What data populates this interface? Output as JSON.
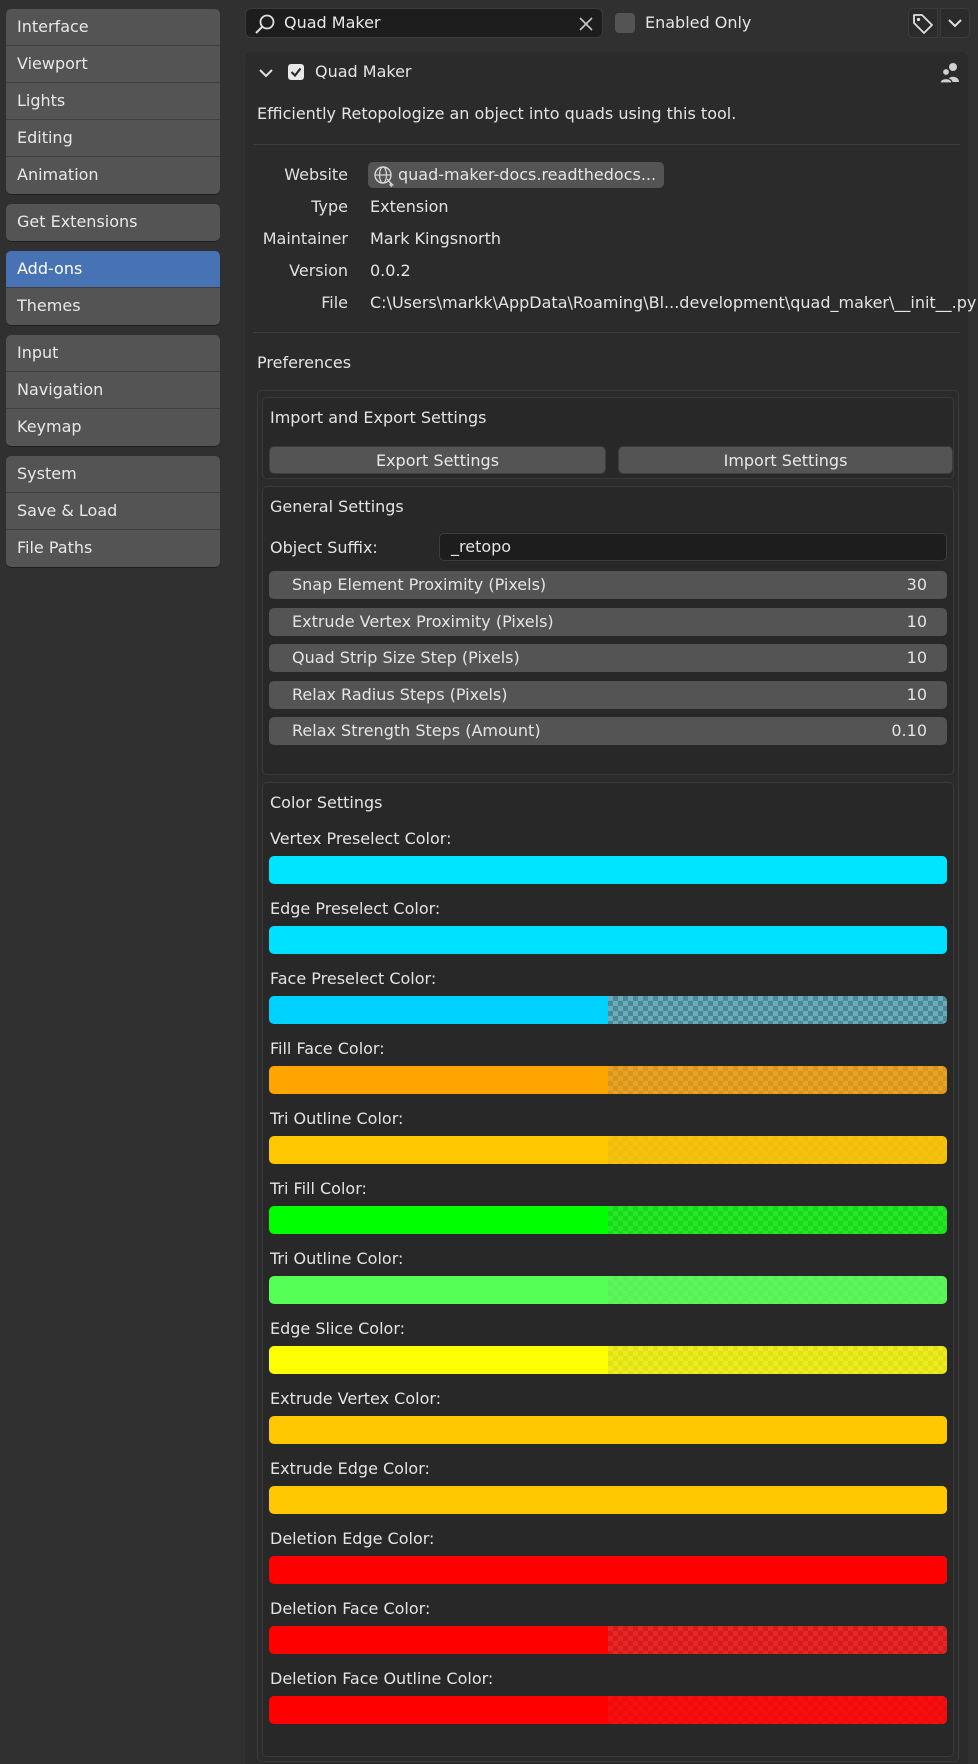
{
  "sidebar": {
    "groups": [
      [
        "Interface",
        "Viewport",
        "Lights",
        "Editing",
        "Animation"
      ],
      [
        "Get Extensions"
      ],
      [
        "Add-ons",
        "Themes"
      ],
      [
        "Input",
        "Navigation",
        "Keymap"
      ],
      [
        "System",
        "Save & Load",
        "File Paths"
      ]
    ],
    "active": "Add-ons"
  },
  "topbar": {
    "search_value": "Quad Maker",
    "enabled_only_label": "Enabled Only",
    "enabled_only_checked": false
  },
  "addon": {
    "name": "Quad Maker",
    "enabled": true,
    "description": "Efficiently Retopologize an object into quads using this tool.",
    "info": {
      "website_label": "Website",
      "website": "quad-maker-docs.readthedocs...",
      "type_label": "Type",
      "type": "Extension",
      "maintainer_label": "Maintainer",
      "maintainer": "Mark Kingsnorth",
      "version_label": "Version",
      "version": "0.0.2",
      "file_label": "File",
      "file": "C:\\Users\\markk\\AppData\\Roaming\\Bl...development\\quad_maker\\__init__.py"
    }
  },
  "preferences": {
    "label": "Preferences",
    "import_export": {
      "title": "Import and Export Settings",
      "export_label": "Export Settings",
      "import_label": "Import Settings"
    },
    "general": {
      "title": "General Settings",
      "object_suffix_label": "Object Suffix:",
      "object_suffix_value": "_retopo",
      "sliders": [
        {
          "label": "Snap Element Proximity (Pixels)",
          "value": "30"
        },
        {
          "label": "Extrude Vertex Proximity (Pixels)",
          "value": "10"
        },
        {
          "label": "Quad Strip Size Step (Pixels)",
          "value": "10"
        },
        {
          "label": "Relax Radius Steps (Pixels)",
          "value": "10"
        },
        {
          "label": "Relax Strength Steps (Amount)",
          "value": "0.10"
        }
      ]
    },
    "colors": {
      "title": "Color Settings",
      "items": [
        {
          "label": "Vertex Preselect Color:",
          "color": "#00e5ff",
          "alpha": 1.0
        },
        {
          "label": "Edge Preselect Color:",
          "color": "#00e1ff",
          "alpha": 1.0
        },
        {
          "label": "Face Preselect Color:",
          "color": "#00d2ff",
          "alpha": 0.3
        },
        {
          "label": "Fill Face Color:",
          "color": "#ffa500",
          "alpha": 0.75
        },
        {
          "label": "Tri Outline Color:",
          "color": "#ffc800",
          "alpha": 0.9
        },
        {
          "label": "Tri Fill Color:",
          "color": "#00ff00",
          "alpha": 0.75
        },
        {
          "label": "Tri Outline Color:",
          "color": "#55ff55",
          "alpha": 0.9
        },
        {
          "label": "Edge Slice Color:",
          "color": "#ffff00",
          "alpha": 0.8
        },
        {
          "label": "Extrude Vertex Color:",
          "color": "#ffc800",
          "alpha": 1.0
        },
        {
          "label": "Extrude Edge Color:",
          "color": "#ffc800",
          "alpha": 1.0
        },
        {
          "label": "Deletion Edge Color:",
          "color": "#ff0000",
          "alpha": 1.0
        },
        {
          "label": "Deletion Face Color:",
          "color": "#ff0000",
          "alpha": 0.75
        },
        {
          "label": "Deletion Face Outline Color:",
          "color": "#ff0000",
          "alpha": 0.9
        }
      ]
    }
  }
}
